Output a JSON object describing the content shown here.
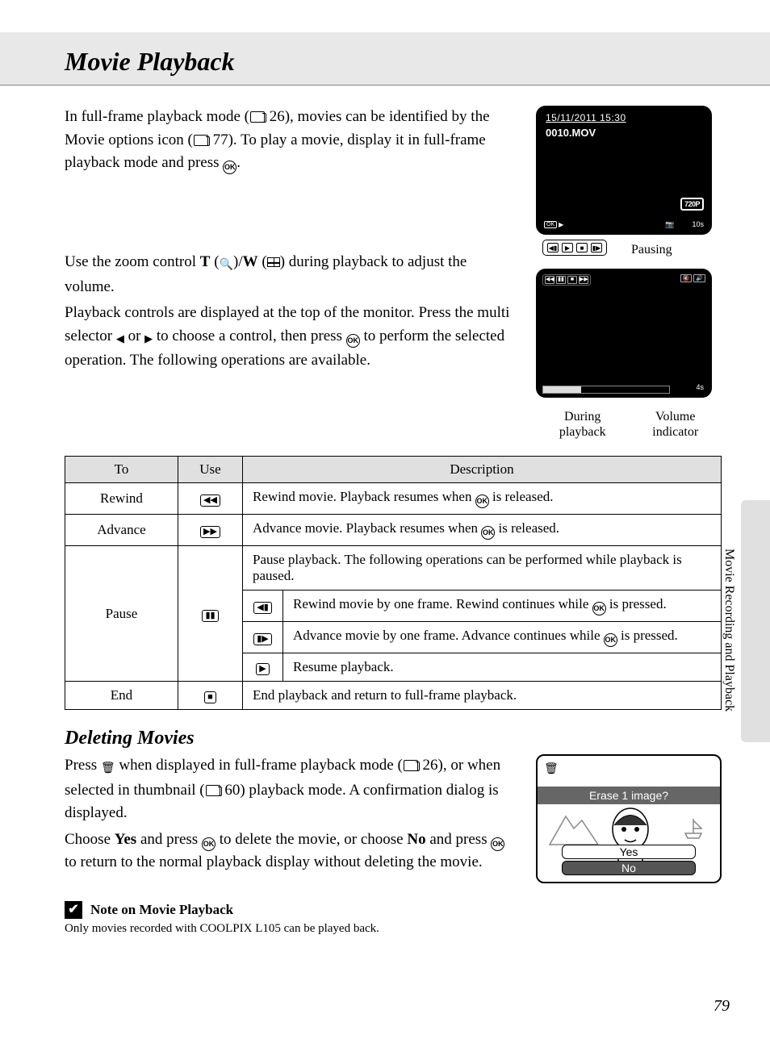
{
  "title": "Movie Playback",
  "intro": {
    "p1_a": "In full-frame playback mode (",
    "p1_ref1": "26",
    "p1_b": "), movies can be identified by the Movie options icon (",
    "p1_ref2": "77",
    "p1_c": "). To play a movie, display it in full-frame playback mode and press ",
    "p1_d": "."
  },
  "lcd1": {
    "datetime": "15/11/2011 15:30",
    "filename": "0010.MOV",
    "resolution": "720P",
    "duration": "10s"
  },
  "para2": {
    "a": "Use the zoom control ",
    "t": "T",
    "w": "W",
    "b": " during playback to adjust the volume.",
    "c": "Playback controls are displayed at the top of the monitor. Press the multi selector ",
    "d": " or ",
    "e": " to choose a control, then press ",
    "f": " to perform the selected operation. The following operations are available."
  },
  "lcd2": {
    "pausing_label": "Pausing",
    "duration": "4s",
    "annot1": "During\nplayback",
    "annot2": "Volume\nindicator"
  },
  "table": {
    "h_to": "To",
    "h_use": "Use",
    "h_desc": "Description",
    "rows": [
      {
        "to": "Rewind",
        "use": "◀◀",
        "desc_a": "Rewind movie. Playback resumes when ",
        "desc_b": " is released."
      },
      {
        "to": "Advance",
        "use": "▶▶",
        "desc_a": "Advance movie. Playback resumes when ",
        "desc_b": " is released."
      },
      {
        "to": "Pause",
        "use": "▮▮",
        "desc": "Pause playback. The following operations can be performed while playback is paused.",
        "subs": [
          {
            "icon": "◀▮",
            "desc_a": "Rewind movie by one frame. Rewind continues while ",
            "desc_b": " is pressed."
          },
          {
            "icon": "▮▶",
            "desc_a": "Advance movie by one frame. Advance continues while ",
            "desc_b": " is pressed."
          },
          {
            "icon": "▶",
            "desc": "Resume playback."
          }
        ]
      },
      {
        "to": "End",
        "use": "■",
        "desc": "End playback and return to full-frame playback."
      }
    ]
  },
  "deleting": {
    "title": "Deleting Movies",
    "p1_a": "Press ",
    "p1_b": " when displayed in full-frame playback mode (",
    "p1_ref1": "26",
    "p1_c": "), or when selected in thumbnail (",
    "p1_ref2": "60",
    "p1_d": ") playback mode. A confirmation dialog is displayed.",
    "p2_a": "Choose ",
    "p2_yes": "Yes",
    "p2_b": " and press ",
    "p2_c": " to delete the movie, or choose ",
    "p2_no": "No",
    "p2_d": " and press ",
    "p2_e": " to return to the normal playback display without deleting the movie.",
    "dialog": {
      "prompt": "Erase 1 image?",
      "yes": "Yes",
      "no": "No"
    }
  },
  "note": {
    "title": "Note on Movie Playback",
    "body": "Only movies recorded with COOLPIX L105 can be played back."
  },
  "side_label": "Movie Recording and Playback",
  "page_number": "79"
}
